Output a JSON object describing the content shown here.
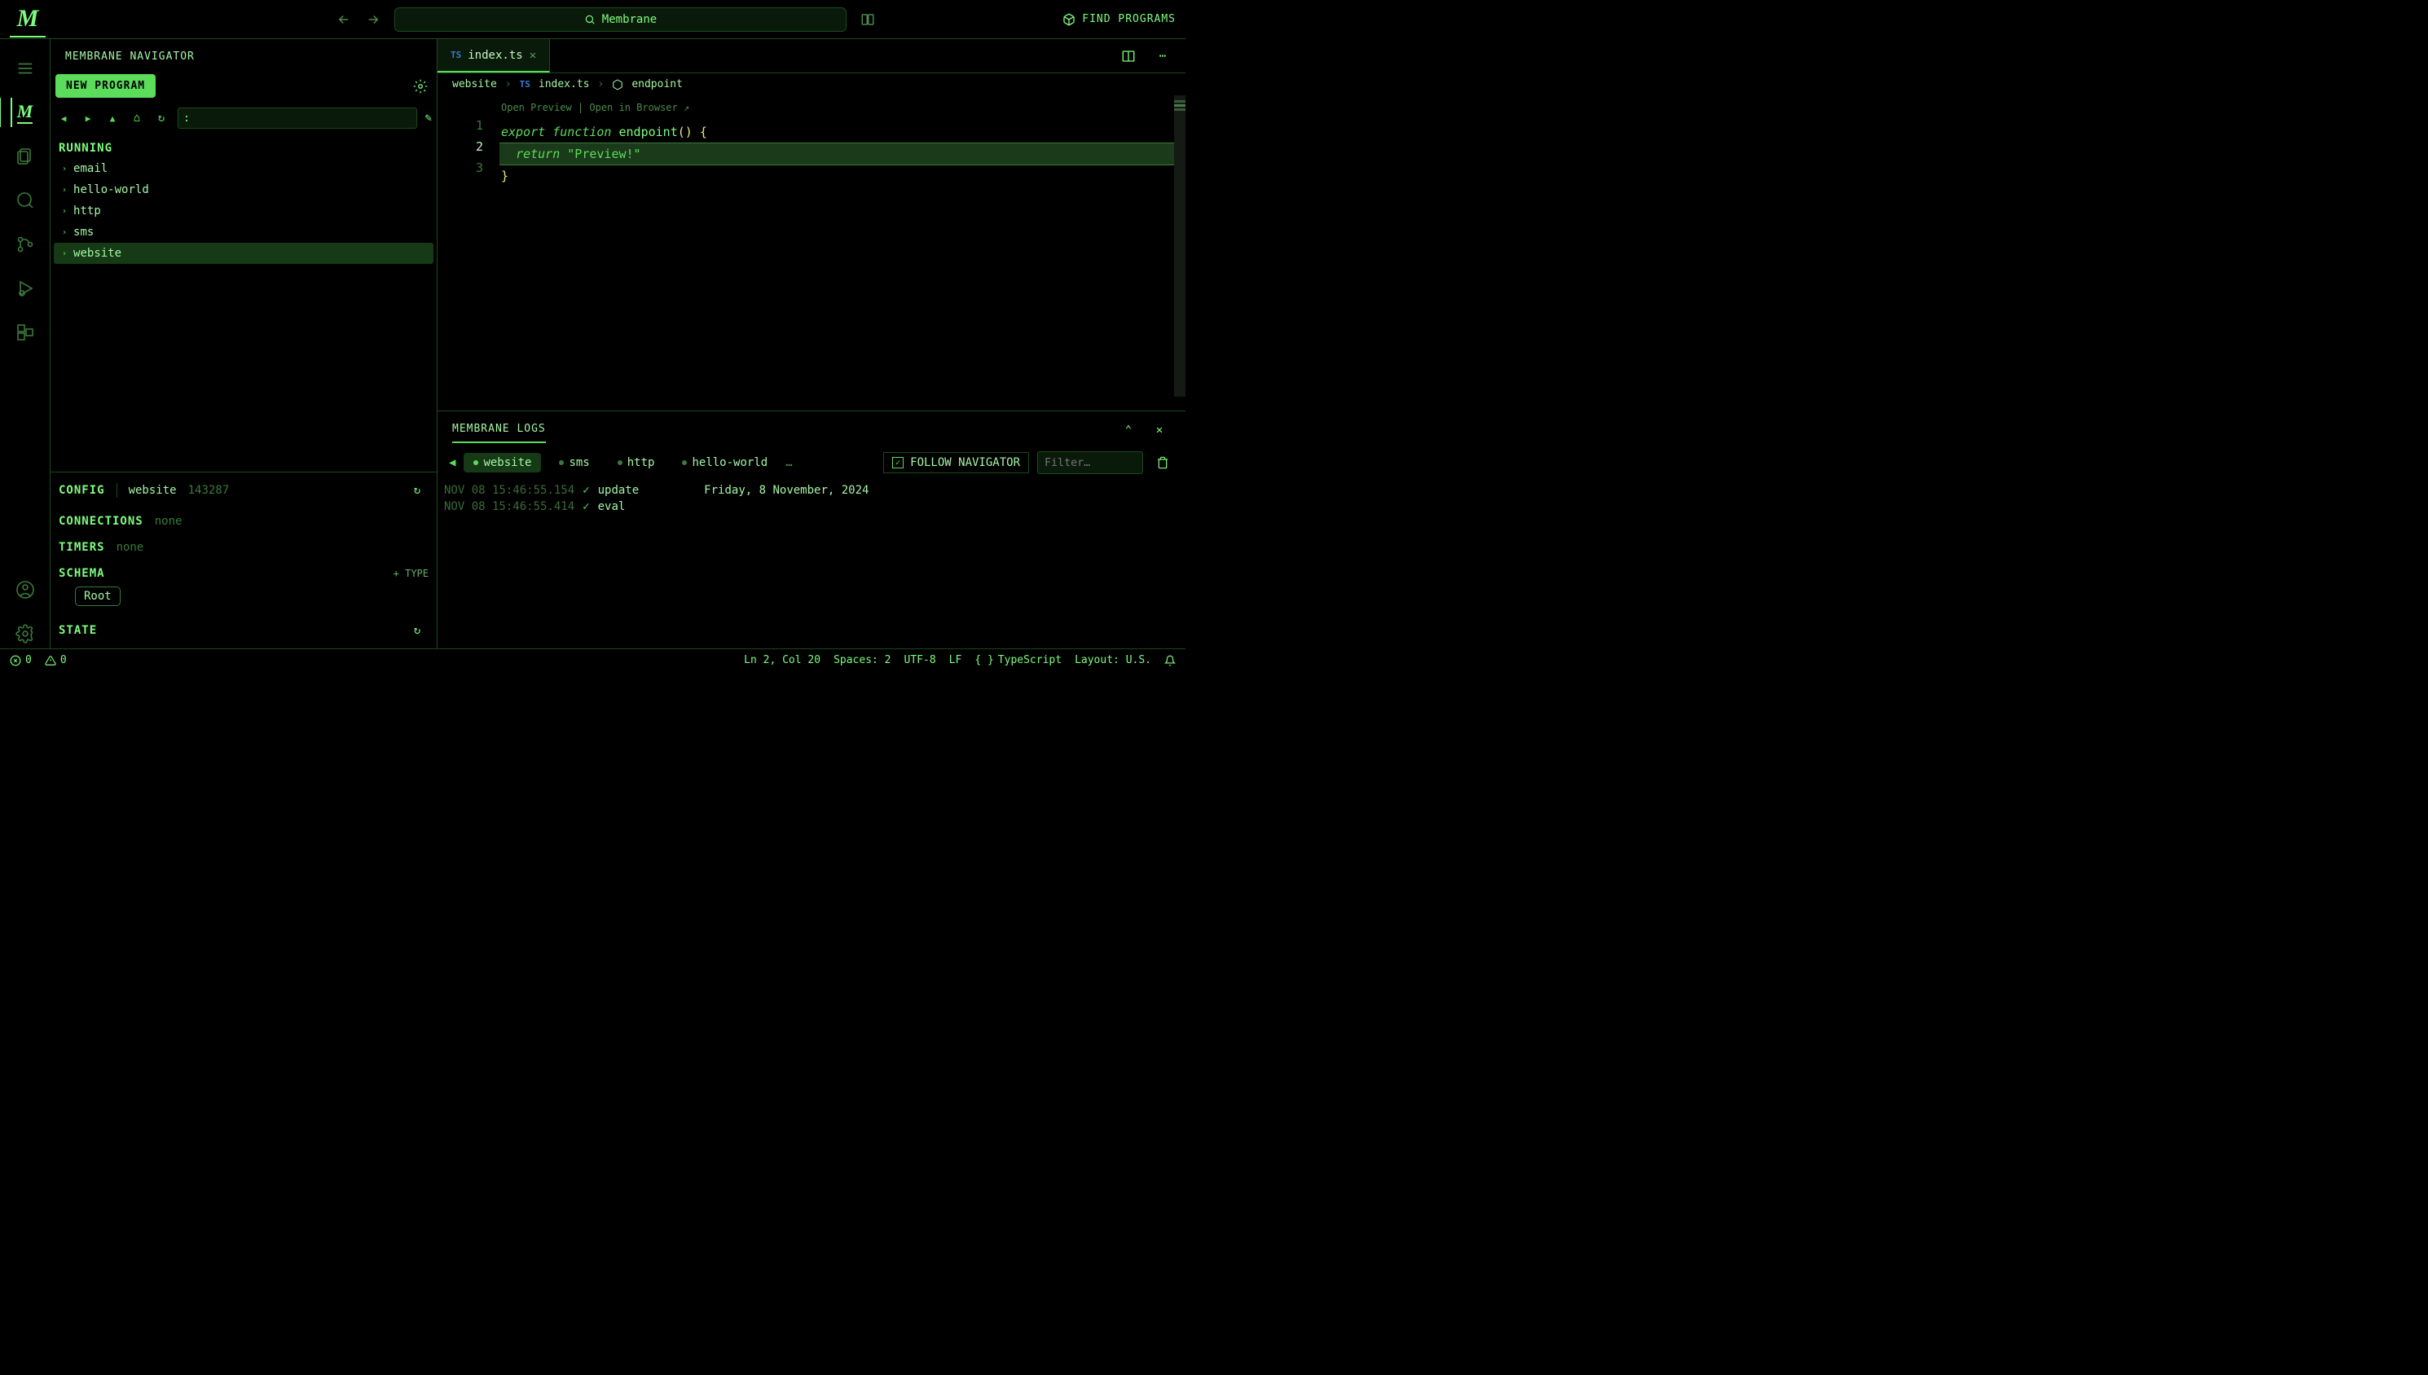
{
  "titlebar": {
    "app_name": "Membrane",
    "find_programs": "FIND PROGRAMS"
  },
  "sidebar": {
    "title": "MEMBRANE NAVIGATOR",
    "new_program": "NEW PROGRAM",
    "input_value": ":",
    "running_label": "RUNNING",
    "programs": [
      "email",
      "hello-world",
      "http",
      "sms",
      "website"
    ]
  },
  "config": {
    "config_label": "CONFIG",
    "config_name": "website",
    "config_id": "143287",
    "connections_label": "CONNECTIONS",
    "connections_val": "none",
    "timers_label": "TIMERS",
    "timers_val": "none",
    "schema_label": "SCHEMA",
    "schema_type": "+ TYPE",
    "schema_root": "Root",
    "state_label": "STATE"
  },
  "editor": {
    "tab_file": "index.ts",
    "breadcrumb": {
      "p0": "website",
      "p1": "index.ts",
      "p2": "endpoint"
    },
    "codelens": "Open Preview | Open in Browser ↗",
    "lines": {
      "l1a": "export",
      "l1b": "function",
      "l1c": "endpoint",
      "l1d": "()",
      "l1e": "{",
      "l2a": "return",
      "l2b": "\"Preview!\"",
      "l3": "}"
    },
    "line_numbers": [
      "1",
      "2",
      "3"
    ]
  },
  "panel": {
    "title": "MEMBRANE LOGS",
    "chips": [
      "website",
      "sms",
      "http",
      "hello-world"
    ],
    "more": "…",
    "follow": "FOLLOW NAVIGATOR",
    "filter_placeholder": "Filter…",
    "logs": [
      {
        "ts": "NOV 08 15:46:55.154",
        "check": "✓",
        "action": "update",
        "extra": "Friday, 8 November, 2024"
      },
      {
        "ts": "NOV 08 15:46:55.414",
        "check": "✓",
        "action": "eval",
        "extra": ""
      }
    ]
  },
  "status": {
    "errors": "0",
    "warnings": "0",
    "ln_col": "Ln 2, Col 20",
    "spaces": "Spaces: 2",
    "encoding": "UTF-8",
    "eol": "LF",
    "lang": "TypeScript",
    "layout": "Layout: U.S."
  }
}
